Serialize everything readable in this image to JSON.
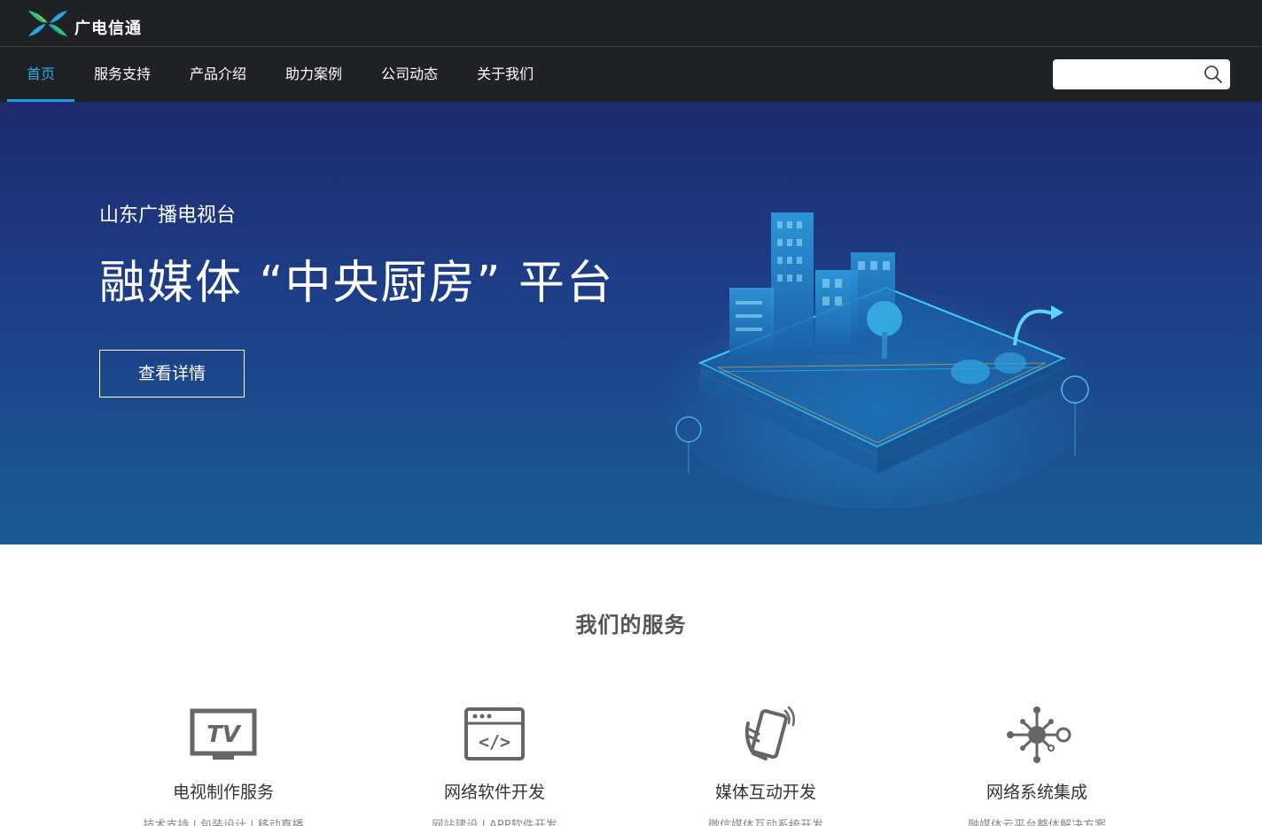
{
  "header": {
    "brand": "广电信通"
  },
  "nav": {
    "items": [
      {
        "label": "首页",
        "active": true
      },
      {
        "label": "服务支持",
        "active": false
      },
      {
        "label": "产品介绍",
        "active": false
      },
      {
        "label": "助力案例",
        "active": false
      },
      {
        "label": "公司动态",
        "active": false
      },
      {
        "label": "关于我们",
        "active": false
      }
    ],
    "search": {
      "value": "",
      "placeholder": ""
    }
  },
  "hero": {
    "subtitle": "山东广播电视台",
    "title": "融媒体 “中央厨房” 平台",
    "button": "查看详情"
  },
  "services": {
    "title": "我们的服务",
    "items": [
      {
        "icon": "tv-icon",
        "name": "电视制作服务",
        "desc": "技术支持 | 包装设计 | 移动直播"
      },
      {
        "icon": "code-window-icon",
        "name": "网络软件开发",
        "desc": "网站建设 | APP软件开发"
      },
      {
        "icon": "phone-hand-icon",
        "name": "媒体互动开发",
        "desc": "微信媒体互动系统开发"
      },
      {
        "icon": "network-icon",
        "name": "网络系统集成",
        "desc": "融媒体云平台整体解决方案"
      }
    ]
  },
  "colors": {
    "nav_bg": "#202124",
    "accent": "#1e9ede",
    "hero_top": "#1e2a6e",
    "hero_bottom": "#1a5a94"
  }
}
